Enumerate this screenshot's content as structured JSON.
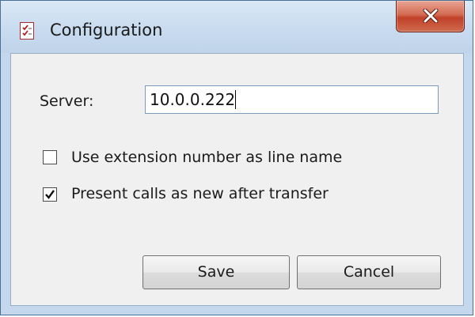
{
  "window": {
    "title": "Configuration"
  },
  "form": {
    "server_label": "Server:",
    "server_value": "10.0.0.222",
    "options": [
      {
        "label": "Use extension number as line name",
        "checked": false
      },
      {
        "label": "Present calls as new after transfer",
        "checked": true
      }
    ]
  },
  "buttons": {
    "save": "Save",
    "cancel": "Cancel"
  },
  "icons": {
    "app": "checklist-icon",
    "close": "close-icon",
    "check": "checkmark-icon"
  },
  "colors": {
    "title_bar": "#c8dbef",
    "close_button": "#c94a33",
    "client_background": "#f0f0f0"
  }
}
